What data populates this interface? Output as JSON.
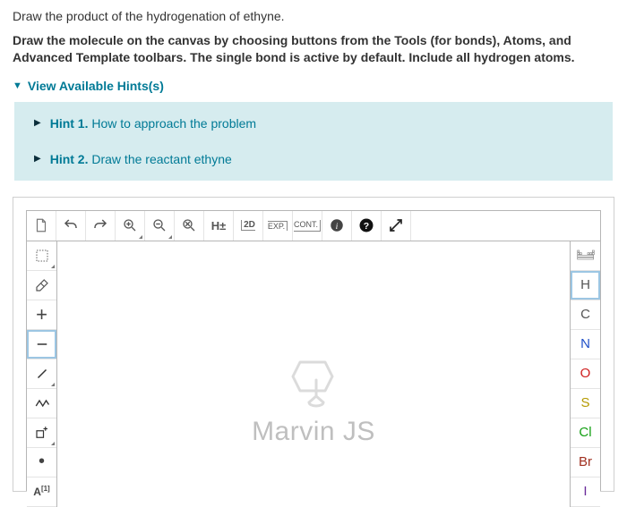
{
  "question": {
    "line1": "Draw the product of the hydrogenation of ethyne.",
    "line2": "Draw the molecule on the canvas by choosing buttons from the Tools (for bonds), Atoms, and Advanced Template toolbars. The single bond is active by default. Include all hydrogen atoms."
  },
  "hints": {
    "toggle_label": "View Available Hints(s)",
    "items": [
      {
        "label": "Hint 1.",
        "text": "How to approach the problem"
      },
      {
        "label": "Hint 2.",
        "text": "Draw the reactant ethyne"
      }
    ]
  },
  "top_toolbar": {
    "new": "new-document-icon",
    "undo": "undo-icon",
    "redo": "redo-icon",
    "zoom_in": "zoom-in-icon",
    "zoom_out": "zoom-out-icon",
    "zoom_reset": "zoom-reset-icon",
    "h_toggle": "H±",
    "clean2d": "2D",
    "exp": "EXP.",
    "cont": "CONT.",
    "info": "info-icon",
    "help": "help-icon",
    "fullscreen": "fullscreen-icon"
  },
  "left_toolbar": {
    "select": "selection-icon",
    "erase": "eraser-icon",
    "plus": "+",
    "single": "—",
    "single_slash": "／",
    "chain": "chain-icon",
    "increase_charge": "charge-icon",
    "radical": "•",
    "abbrev": "A",
    "abbrev_sup": "[1]"
  },
  "right_toolbar": {
    "periodic": "periodic-table-icon",
    "atoms": [
      "H",
      "C",
      "N",
      "O",
      "S",
      "Cl",
      "Br",
      "I"
    ]
  },
  "canvas": {
    "watermark": "Marvin JS"
  }
}
